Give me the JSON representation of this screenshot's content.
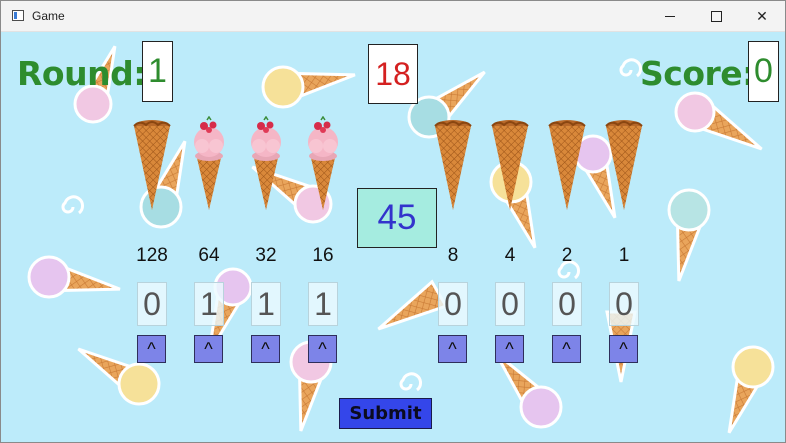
{
  "window": {
    "title": "Game"
  },
  "round": {
    "label": "Round:",
    "value": "1"
  },
  "score": {
    "label": "Score:",
    "value": "0"
  },
  "timer": {
    "value": "18"
  },
  "target": {
    "value": "45"
  },
  "columns": [
    {
      "weight": "128",
      "bit": "0",
      "cone": "empty-cone-icon"
    },
    {
      "weight": "64",
      "bit": "1",
      "cone": "strawberry-ice-cream-cone-icon"
    },
    {
      "weight": "32",
      "bit": "1",
      "cone": "strawberry-ice-cream-cone-icon"
    },
    {
      "weight": "16",
      "bit": "1",
      "cone": "strawberry-ice-cream-cone-icon"
    },
    {
      "weight": "8",
      "bit": "0",
      "cone": "empty-cone-icon"
    },
    {
      "weight": "4",
      "bit": "0",
      "cone": "empty-cone-icon"
    },
    {
      "weight": "2",
      "bit": "0",
      "cone": "empty-cone-icon"
    },
    {
      "weight": "1",
      "bit": "0",
      "cone": "empty-cone-icon"
    }
  ],
  "increment_label": "^",
  "submit_label": "Submit",
  "colors": {
    "background": "#bcebfa",
    "label_green": "#2e8c2e",
    "timer_red": "#d42020",
    "target_bg": "#a5ece0",
    "target_text": "#3333cc",
    "button_blue": "#3446ea",
    "increment_bg": "#7d84e8"
  }
}
